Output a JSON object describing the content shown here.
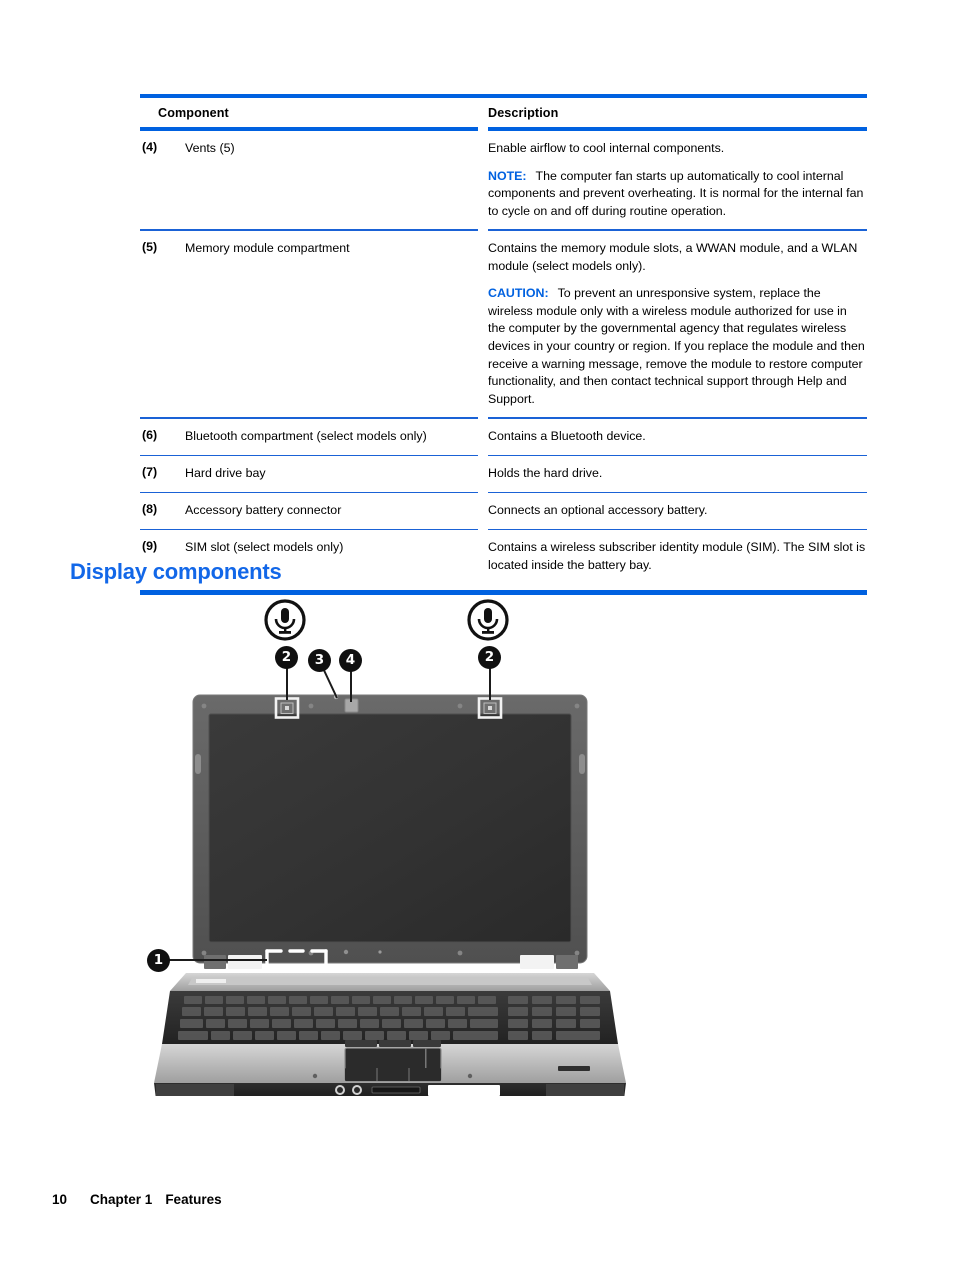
{
  "table": {
    "headers": {
      "number": "",
      "component": "Component",
      "description": "Description"
    },
    "rows": [
      {
        "number": "(4)",
        "component": "Vents (5)",
        "description_main": "Enable airflow to cool internal components.",
        "note_label": "NOTE:",
        "note_text": "The computer fan starts up automatically to cool internal components and prevent overheating. It is normal for the internal fan to cycle on and off during routine operation."
      },
      {
        "number": "(5)",
        "component": "Memory module compartment",
        "description_main": "Contains the memory module slots, a WWAN module, and a WLAN module (select models only).",
        "note_label": "CAUTION:",
        "note_text": "To prevent an unresponsive system, replace the wireless module only with a wireless module authorized for use in the computer by the governmental agency that regulates wireless devices in your country or region. If you replace the module and then receive a warning message, remove the module to restore computer functionality, and then contact technical support through Help and Support."
      },
      {
        "number": "(6)",
        "component": "Bluetooth compartment (select models only)",
        "description_main": "Contains a Bluetooth device.",
        "note_label": "",
        "note_text": ""
      },
      {
        "number": "(7)",
        "component": "Hard drive bay",
        "description_main": "Holds the hard drive.",
        "note_label": "",
        "note_text": ""
      },
      {
        "number": "(8)",
        "component": "Accessory battery connector",
        "description_main": "Connects an optional accessory battery.",
        "note_label": "",
        "note_text": ""
      },
      {
        "number": "(9)",
        "component": "SIM slot (select models only)",
        "description_main": "Contains a wireless subscriber identity module (SIM). The SIM slot is located inside the battery bay.",
        "note_label": "",
        "note_text": ""
      }
    ]
  },
  "section": {
    "heading": "Display components"
  },
  "figure": {
    "callouts": [
      {
        "id": "callout-1",
        "label": "1"
      },
      {
        "id": "callout-2-left",
        "label": "2"
      },
      {
        "id": "callout-3",
        "label": "3"
      },
      {
        "id": "callout-4",
        "label": "4"
      },
      {
        "id": "callout-2-right",
        "label": "2"
      }
    ],
    "icons": [
      {
        "id": "microphone-icon-left",
        "name": "microphone-icon"
      },
      {
        "id": "microphone-icon-right",
        "name": "microphone-icon"
      }
    ]
  },
  "footer": {
    "page_number": "10",
    "chapter": "Chapter 1",
    "chapter_title": "Features"
  },
  "colors": {
    "accent_blue": "#0061e0",
    "heading_blue": "#1267e8"
  }
}
